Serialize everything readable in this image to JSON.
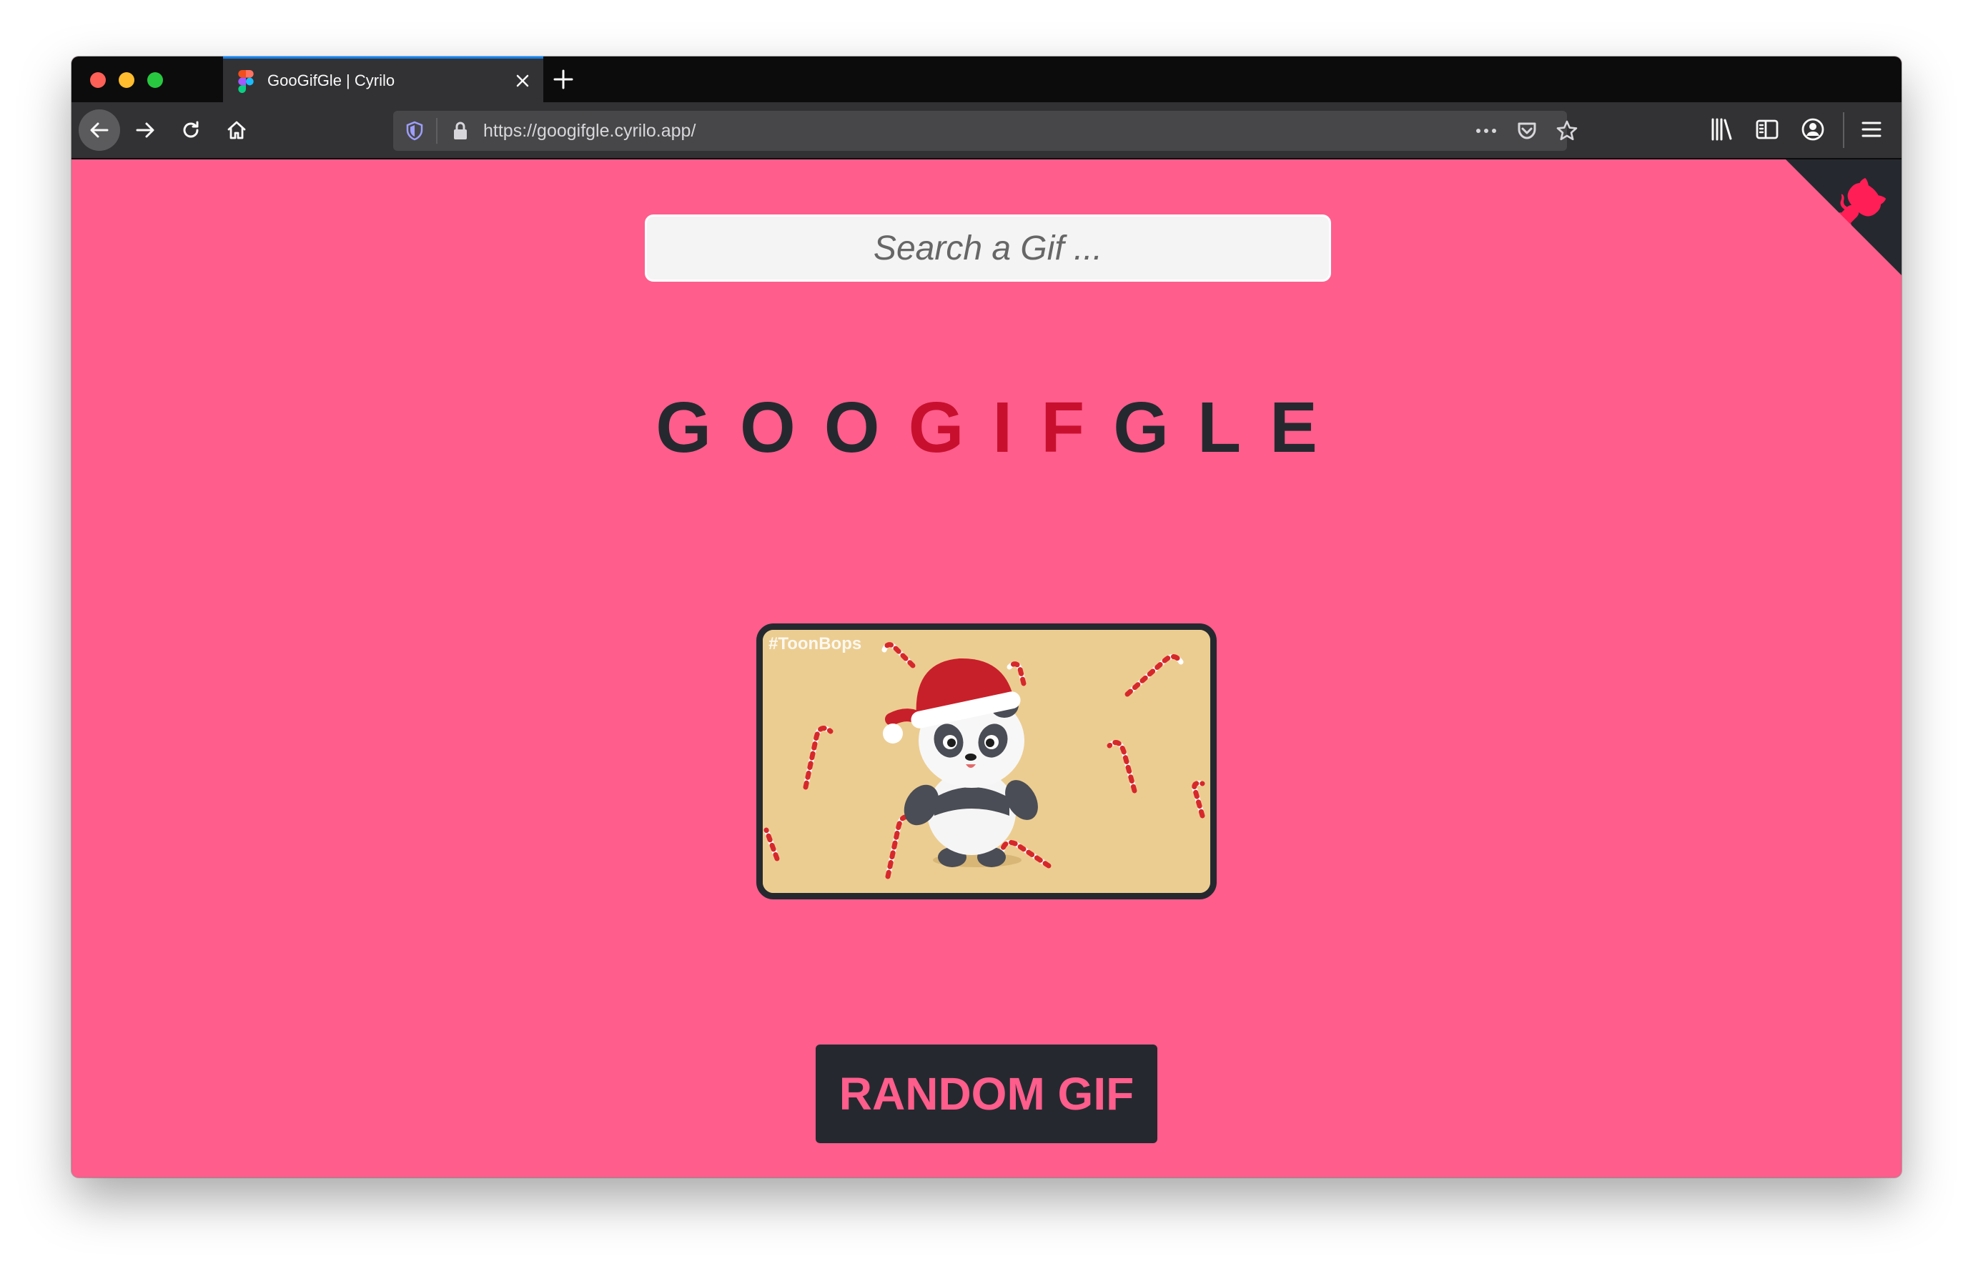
{
  "browser": {
    "tab": {
      "title": "GooGifGle | Cyrilo"
    },
    "url": "https://googifgle.cyrilo.app/",
    "icons": [
      "back-arrow-icon",
      "forward-arrow-icon",
      "reload-icon",
      "home-icon",
      "shield-icon",
      "lock-icon",
      "more-icon",
      "pocket-icon",
      "star-icon",
      "library-icon",
      "sidebar-icon",
      "account-icon",
      "menu-icon",
      "close-icon",
      "plus-icon",
      "figma-icon"
    ]
  },
  "page": {
    "search": {
      "placeholder": "Search a Gif ..."
    },
    "logo": {
      "part1": "GOO",
      "part2": "GIF",
      "part3": "GLE"
    },
    "gif": {
      "watermark": "#ToonBops",
      "description_icon": "panda-santa-hat-gif"
    },
    "random_button": {
      "label": "RANDOM GIF"
    },
    "corner_icon": "github-octocat-icon"
  },
  "colors": {
    "background": "#ff5d8c",
    "dark": "#25292f",
    "accent": "#c8102e",
    "gif_background": "#eccd91"
  }
}
